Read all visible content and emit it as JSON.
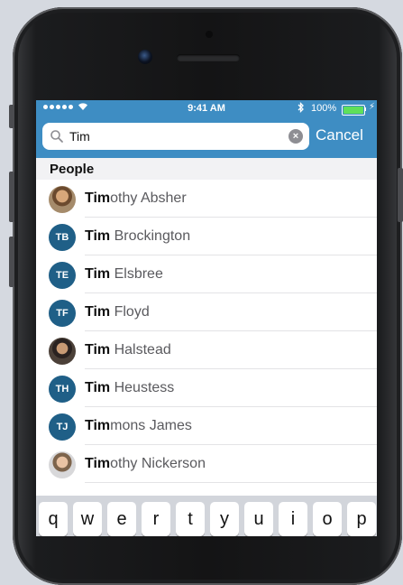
{
  "status_bar": {
    "time": "9:41 AM",
    "battery_percent": "100%",
    "signal_icon": "signal-dots-icon",
    "wifi_icon": "wifi-icon",
    "bluetooth_icon": "bluetooth-icon",
    "charging_icon": "bolt-icon",
    "battery_level": 1.0
  },
  "search": {
    "value": "Tim",
    "cancel_label": "Cancel",
    "clear_icon": "clear-icon"
  },
  "colors": {
    "header": "#3e8dc3",
    "avatar": "#1f5f87",
    "battery": "#5fe05a"
  },
  "section": {
    "title": "People"
  },
  "people": [
    {
      "match": "Tim",
      "rest": "othy Absher",
      "initials": "",
      "avatar": "photo"
    },
    {
      "match": "Tim",
      "rest": " Brockington",
      "initials": "TB",
      "avatar": "initials"
    },
    {
      "match": "Tim",
      "rest": " Elsbree",
      "initials": "TE",
      "avatar": "initials"
    },
    {
      "match": "Tim",
      "rest": " Floyd",
      "initials": "TF",
      "avatar": "initials"
    },
    {
      "match": "Tim",
      "rest": " Halstead",
      "initials": "",
      "avatar": "photo2"
    },
    {
      "match": "Tim",
      "rest": " Heustess",
      "initials": "TH",
      "avatar": "initials"
    },
    {
      "match": "Tim",
      "rest": "mons James",
      "initials": "TJ",
      "avatar": "initials"
    },
    {
      "match": "Tim",
      "rest": "othy Nickerson",
      "initials": "",
      "avatar": "photo3"
    }
  ],
  "keyboard": {
    "row1": [
      "q",
      "w",
      "e",
      "r",
      "t",
      "y",
      "u",
      "i",
      "o",
      "p"
    ]
  }
}
